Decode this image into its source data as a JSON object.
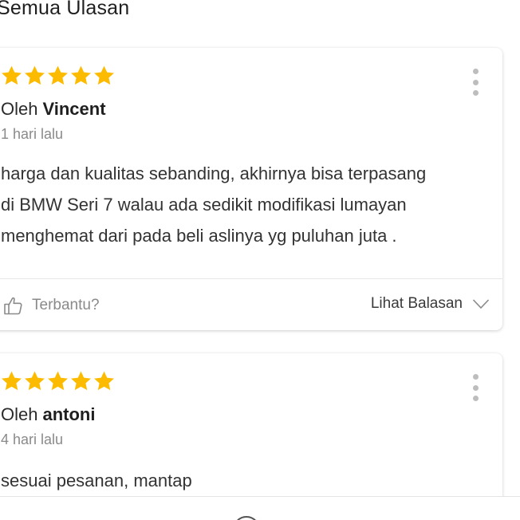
{
  "section": {
    "title": "Semua Ulasan"
  },
  "colors": {
    "star": "#FDBB00",
    "kebab": "#BDBDBD",
    "muted": "#8A8A8A"
  },
  "reviews": [
    {
      "rating": 5,
      "by_prefix": "Oleh",
      "author": "Vincent",
      "date": "1 hari lalu",
      "lines": [
        "harga dan kualitas sebanding, akhirnya bisa terpasang",
        "di BMW Seri 7 walau ada sedikit modifikasi lumayan",
        "menghemat dari pada beli aslinya yg puluhan juta ."
      ],
      "helpful_label": "Terbantu?",
      "replies_label": "Lihat Balasan"
    },
    {
      "rating": 5,
      "by_prefix": "Oleh",
      "author": "antoni",
      "date": "4 hari lalu",
      "lines": [
        "sesuai pesanan, mantap"
      ]
    }
  ],
  "icons": {
    "star": "star-icon",
    "more": "more-vertical-icon",
    "helpful": "thumbs-up-icon",
    "expand": "chevron-down-icon"
  }
}
